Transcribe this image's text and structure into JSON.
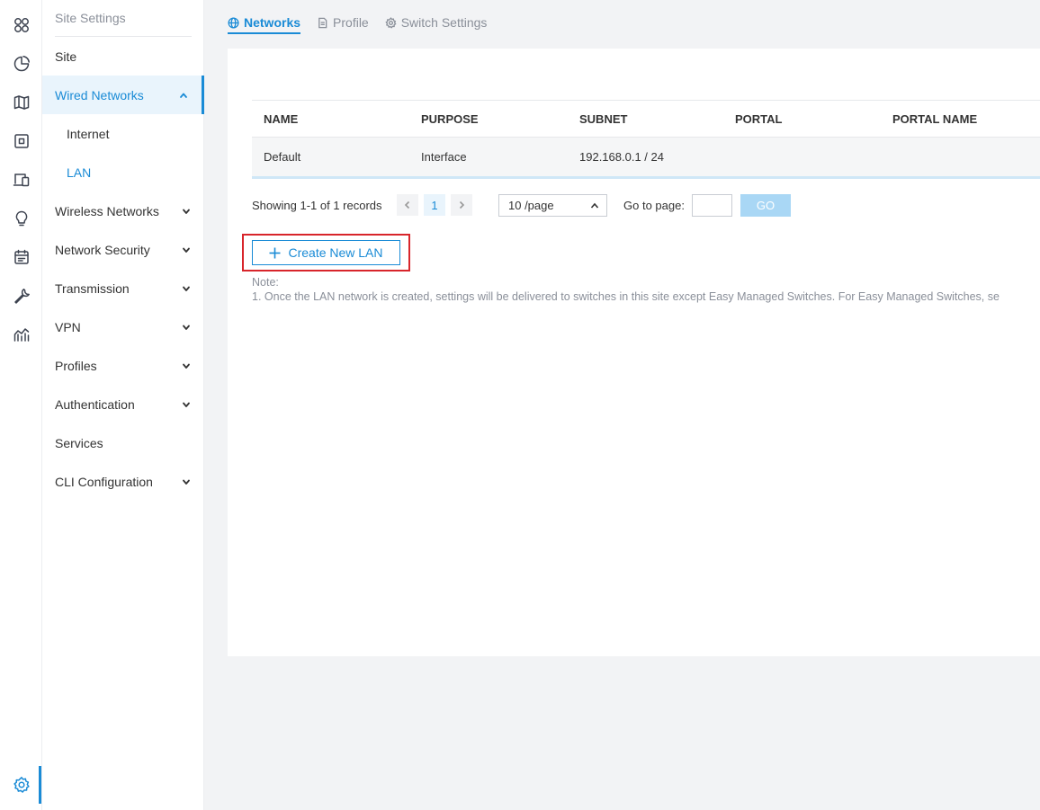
{
  "rail": {
    "icons": [
      "dashboard-icon",
      "statistics-icon",
      "map-icon",
      "devices-icon",
      "clients-icon",
      "insights-icon",
      "logs-icon",
      "tools-icon",
      "reports-icon",
      "settings-icon"
    ]
  },
  "submenu": {
    "title": "Site Settings",
    "items": [
      {
        "label": "Site"
      },
      {
        "label": "Wired Networks"
      },
      {
        "label": "Internet"
      },
      {
        "label": "LAN"
      },
      {
        "label": "Wireless Networks"
      },
      {
        "label": "Network Security"
      },
      {
        "label": "Transmission"
      },
      {
        "label": "VPN"
      },
      {
        "label": "Profiles"
      },
      {
        "label": "Authentication"
      },
      {
        "label": "Services"
      },
      {
        "label": "CLI Configuration"
      }
    ]
  },
  "tabs": [
    {
      "label": "Networks",
      "icon": "globe-icon"
    },
    {
      "label": "Profile",
      "icon": "document-icon"
    },
    {
      "label": "Switch Settings",
      "icon": "gear-icon"
    }
  ],
  "table": {
    "headers": [
      "NAME",
      "PURPOSE",
      "SUBNET",
      "PORTAL",
      "PORTAL NAME"
    ],
    "rows": [
      [
        "Default",
        "Interface",
        "192.168.0.1 / 24",
        "",
        ""
      ]
    ]
  },
  "pagination": {
    "showing": "Showing 1-1 of 1 records",
    "current_page": "1",
    "page_size": "10 /page",
    "goto_label": "Go to page:",
    "go_label": "GO"
  },
  "create_button": {
    "label": "Create New LAN"
  },
  "note": {
    "title": "Note:",
    "line1": "1. Once the LAN network is created, settings will be delivered to switches in this site except Easy Managed Switches. For Easy Managed Switches, se"
  },
  "colors": {
    "accent": "#1a8bd6",
    "highlight_border": "#d8252b"
  }
}
